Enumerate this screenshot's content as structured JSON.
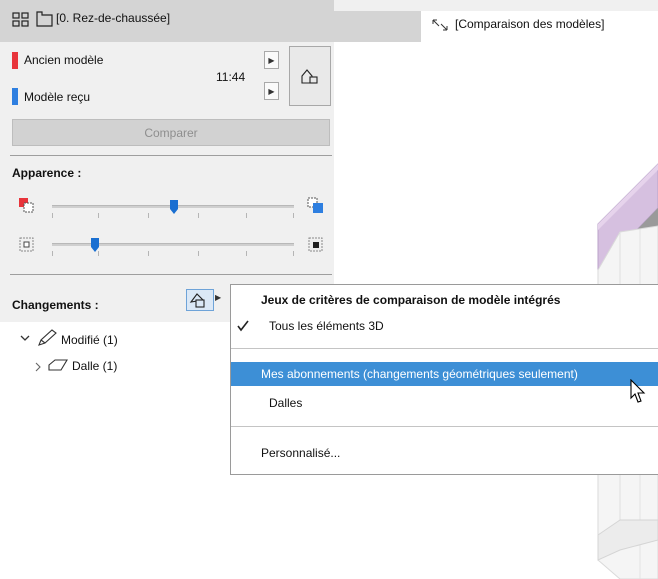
{
  "left_tabbar": {
    "plan_tab_label": "[0. Rez-de-chaussée]"
  },
  "viewport_tab": {
    "label": "[Comparaison des modèles]"
  },
  "models": {
    "old_label": "Ancien modèle",
    "old_color": "#e8343b",
    "received_label": "Modèle reçu",
    "received_color": "#2e7fe0",
    "time": "11:44"
  },
  "compare_button": {
    "label": "Comparer"
  },
  "appearance": {
    "title": "Apparence :",
    "slider_1_value": 0.5,
    "slider_2_value": 0.17,
    "accent_color": "#1a6fd1"
  },
  "changes": {
    "title": "Changements :",
    "tree": [
      {
        "label": "Modifié (1)",
        "children": [
          {
            "label": "Dalle (1)"
          }
        ]
      }
    ]
  },
  "menu": {
    "heading": "Jeux de critères de comparaison de modèle intégrés",
    "item_all_3d": "Tous les éléments 3D",
    "item_subscriptions": "Mes abonnements (changements géométriques seulement)",
    "item_slabs": "Dalles",
    "item_custom": "Personnalisé...",
    "highlight_color": "#3d8fd6"
  },
  "icons": [
    "grid-icon",
    "plan-icon",
    "camera-icon",
    "arrow-right-icon",
    "update-icon",
    "red-square-icon",
    "blue-square-icon",
    "small-square-icon",
    "dark-square-icon",
    "filter-shapes-icon",
    "chevron-down-icon",
    "pencil-icon",
    "chevron-right-icon",
    "eye-icon",
    "checkmark-icon",
    "mouse-cursor-icon"
  ]
}
